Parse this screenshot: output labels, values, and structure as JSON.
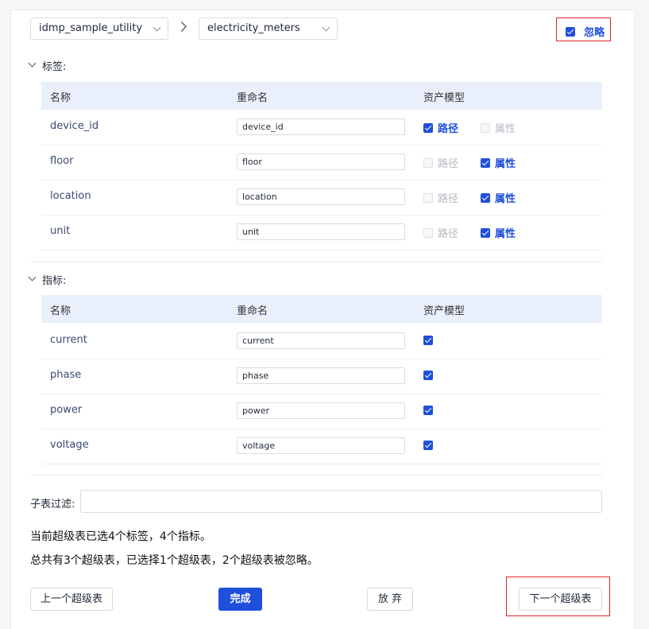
{
  "header": {
    "db_select": "idmp_sample_utility",
    "table_select": "electricity_meters",
    "ignore_label": "忽略",
    "ignore_checked": true
  },
  "tags_section": {
    "title": "标签:",
    "columns": [
      "名称",
      "重命名",
      "资产模型"
    ],
    "rows": [
      {
        "name": "device_id",
        "rename": "device_id",
        "path_label": "路径",
        "path_checked": true,
        "attr_label": "属性",
        "attr_checked": false
      },
      {
        "name": "floor",
        "rename": "floor",
        "path_label": "路径",
        "path_checked": false,
        "attr_label": "属性",
        "attr_checked": true
      },
      {
        "name": "location",
        "rename": "location",
        "path_label": "路径",
        "path_checked": false,
        "attr_label": "属性",
        "attr_checked": true
      },
      {
        "name": "unit",
        "rename": "unit",
        "path_label": "路径",
        "path_checked": false,
        "attr_label": "属性",
        "attr_checked": true
      }
    ]
  },
  "metrics_section": {
    "title": "指标:",
    "columns": [
      "名称",
      "重命名",
      "资产模型"
    ],
    "rows": [
      {
        "name": "current",
        "rename": "current",
        "checked": true
      },
      {
        "name": "phase",
        "rename": "phase",
        "checked": true
      },
      {
        "name": "power",
        "rename": "power",
        "checked": true
      },
      {
        "name": "voltage",
        "rename": "voltage",
        "checked": true
      }
    ]
  },
  "filter": {
    "label": "子表过滤:",
    "value": ""
  },
  "summary": {
    "line1": "当前超级表已选4个标签，4个指标。",
    "line2": "总共有3个超级表，已选择1个超级表，2个超级表被忽略。"
  },
  "buttons": {
    "prev": "上一个超级表",
    "finish": "完成",
    "abandon": "放 弃",
    "next": "下一个超级表"
  },
  "colors": {
    "accent": "#1f4fdb",
    "highlight_box": "#e02424",
    "header_bg": "#e9effb"
  }
}
